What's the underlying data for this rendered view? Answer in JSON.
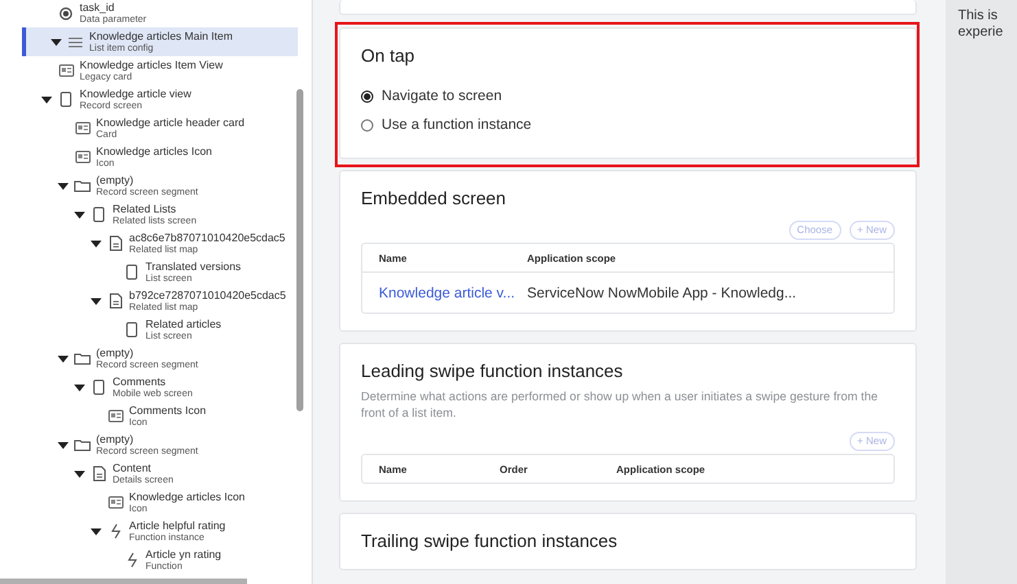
{
  "tree_top_item": {
    "label": "task_id",
    "sublabel": "Data parameter",
    "kind": "parameter"
  },
  "tree": [
    {
      "label": "Knowledge articles Main Item",
      "sublabel": "List item config",
      "kind": "list",
      "selected": true,
      "expanded": true,
      "children": [
        {
          "label": "Knowledge articles Item View",
          "sublabel": "Legacy card",
          "kind": "card",
          "selected": false
        },
        {
          "label": "Knowledge article view",
          "sublabel": "Record screen",
          "kind": "screen",
          "selected": false,
          "expanded": true,
          "children": [
            {
              "label": "Knowledge article header card",
              "sublabel": "Card",
              "kind": "card",
              "selected": false
            },
            {
              "label": "Knowledge articles Icon",
              "sublabel": "Icon",
              "kind": "card",
              "selected": false
            },
            {
              "label": "(empty)",
              "sublabel": "Record screen segment",
              "kind": "folder",
              "selected": false,
              "expanded": true,
              "children": [
                {
                  "label": "Related Lists",
                  "sublabel": "Related lists screen",
                  "kind": "screen",
                  "selected": false,
                  "expanded": true,
                  "children": [
                    {
                      "label": "ac8c6e7b87071010420e5cdac5",
                      "sublabel": "Related list map",
                      "kind": "document",
                      "selected": false,
                      "expanded": true,
                      "children": [
                        {
                          "label": "Translated versions",
                          "sublabel": "List screen",
                          "kind": "screen",
                          "selected": false
                        }
                      ]
                    },
                    {
                      "label": "b792ce7287071010420e5cdac5",
                      "sublabel": "Related list map",
                      "kind": "document",
                      "selected": false,
                      "expanded": true,
                      "children": [
                        {
                          "label": "Related articles",
                          "sublabel": "List screen",
                          "kind": "screen",
                          "selected": false
                        }
                      ]
                    }
                  ]
                }
              ]
            },
            {
              "label": "(empty)",
              "sublabel": "Record screen segment",
              "kind": "folder",
              "selected": false,
              "expanded": true,
              "children": [
                {
                  "label": "Comments",
                  "sublabel": "Mobile web screen",
                  "kind": "screen",
                  "selected": false,
                  "expanded": true,
                  "children": [
                    {
                      "label": "Comments Icon",
                      "sublabel": "Icon",
                      "kind": "card",
                      "selected": false
                    }
                  ]
                }
              ]
            },
            {
              "label": "(empty)",
              "sublabel": "Record screen segment",
              "kind": "folder",
              "selected": false,
              "expanded": true,
              "children": [
                {
                  "label": "Content",
                  "sublabel": "Details screen",
                  "kind": "document",
                  "selected": false,
                  "expanded": true,
                  "children": [
                    {
                      "label": "Knowledge articles Icon",
                      "sublabel": "Icon",
                      "kind": "card",
                      "selected": false
                    },
                    {
                      "label": "Article helpful rating",
                      "sublabel": "Function instance",
                      "kind": "function",
                      "selected": false,
                      "expanded": true,
                      "children": [
                        {
                          "label": "Article yn rating",
                          "sublabel": "Function",
                          "kind": "function",
                          "selected": false
                        }
                      ]
                    }
                  ]
                }
              ]
            }
          ]
        }
      ]
    }
  ],
  "cards": [
    {
      "kind": "radio_group",
      "title": "On tap",
      "highlighted": true,
      "options": [
        {
          "label": "Navigate to screen",
          "selected": true
        },
        {
          "label": "Use a function instance",
          "selected": false
        }
      ]
    },
    {
      "kind": "table",
      "title": "Embedded screen",
      "highlighted": false,
      "buttons": [
        "Choose",
        "+ New"
      ],
      "columns": [
        "Name",
        "Application scope"
      ],
      "rows": [
        [
          {
            "text": "Knowledge article v...",
            "kind": "link"
          },
          {
            "text": "ServiceNow NowMobile App - Knowledg...",
            "kind": "text"
          }
        ]
      ]
    },
    {
      "kind": "table",
      "title": "Leading swipe function instances",
      "highlighted": false,
      "description": "Determine what actions are performed or show up when a user initiates a swipe gesture from the front of a list item.",
      "buttons": [
        "+ New"
      ],
      "columns": [
        "Name",
        "Order",
        "Application scope"
      ]
    },
    {
      "kind": "section",
      "title": "Trailing swipe function instances",
      "highlighted": false
    }
  ],
  "side_panel": {
    "lines": [
      "This is",
      "experie"
    ]
  }
}
